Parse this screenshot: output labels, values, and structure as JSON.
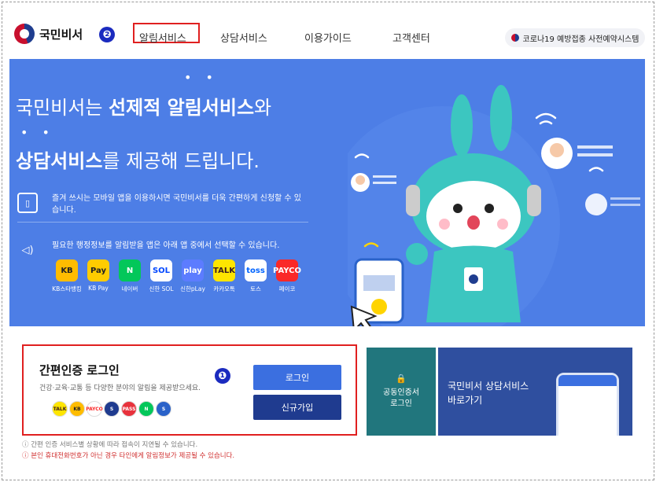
{
  "header": {
    "logo_text": "국민비서",
    "marker": "❷",
    "nav": [
      "알림서비스",
      "상담서비스",
      "이용가이드",
      "고객센터"
    ],
    "covid_button": "코로나19 예방접종 사전예약시스템"
  },
  "hero": {
    "line1_pre": "국민비서는 ",
    "line1_bold": "선제적 알림서비스",
    "line1_post": "와",
    "line2_bold": "상담서비스",
    "line2_post": "를 제공해 드립니다.",
    "info1": "즐겨 쓰시는 모바일 앱을 이용하시면 국민비서를 더욱 간편하게 신청할 수 있습니다.",
    "info2": "필요한 행정정보를 알림받을 앱은 아래 앱 중에서 선택할 수 있습니다.",
    "apps": [
      {
        "icon": "KB",
        "label": "KB스타뱅킹",
        "bg": "#ffbc00",
        "fg": "#222"
      },
      {
        "icon": "Pay",
        "label": "KB Pay",
        "bg": "#ffcc00",
        "fg": "#222"
      },
      {
        "icon": "N",
        "label": "네이버",
        "bg": "#03c75a",
        "fg": "#fff"
      },
      {
        "icon": "SOL",
        "label": "신한 SOL",
        "bg": "#ffffff",
        "fg": "#0046ff"
      },
      {
        "icon": "play",
        "label": "신한pLay",
        "bg": "#5c7cff",
        "fg": "#fff"
      },
      {
        "icon": "TALK",
        "label": "카카오톡",
        "bg": "#fee500",
        "fg": "#3b1e1e"
      },
      {
        "icon": "toss",
        "label": "토스",
        "bg": "#ffffff",
        "fg": "#0064ff"
      },
      {
        "icon": "PAYCO",
        "label": "페이코",
        "bg": "#fa2828",
        "fg": "#fff"
      }
    ]
  },
  "login": {
    "title": "간편인증 로그인",
    "subtitle": "건강·교육·교통 등 다양한 분야의 알림을 제공받으세요.",
    "marker": "❶",
    "login_button": "로그인",
    "join_button": "신규가입",
    "provider_icons": [
      {
        "name": "kakao",
        "bg": "#fee500",
        "fg": "#3b1e1e",
        "text": "TALK"
      },
      {
        "name": "kb",
        "bg": "#ffbc00",
        "fg": "#222",
        "text": "KB"
      },
      {
        "name": "payco",
        "bg": "#ffffff",
        "fg": "#fa2828",
        "text": "PAYCO"
      },
      {
        "name": "samsung",
        "bg": "#1f3b8f",
        "fg": "#fff",
        "text": "S"
      },
      {
        "name": "pass",
        "bg": "#e8323c",
        "fg": "#fff",
        "text": "PASS"
      },
      {
        "name": "naver",
        "bg": "#03c75a",
        "fg": "#fff",
        "text": "N"
      },
      {
        "name": "shinhan",
        "bg": "#2a62c9",
        "fg": "#fff",
        "text": "S"
      }
    ]
  },
  "cert_card": {
    "line1": "공동인증서",
    "line2": "로그인"
  },
  "consult_card": {
    "line1": "국민비서 상담서비스",
    "line2": "바로가기"
  },
  "notices": [
    {
      "text": "간편 인증 서비스별 상황에 따라 접속이 지연될 수 있습니다.",
      "color": "#777777"
    },
    {
      "text": "본인 휴대전화번호가 아닌 경우 타인에게 알림정보가 제공될 수 있습니다.",
      "color": "#d03030"
    }
  ],
  "colors": {
    "hero_bg": "#4d7ee6",
    "accent_red": "#e02020",
    "login_blue": "#3b6fe0",
    "join_navy": "#1f3b8f",
    "cert_teal": "#21767d",
    "consult_navy": "#2f4f9f"
  }
}
